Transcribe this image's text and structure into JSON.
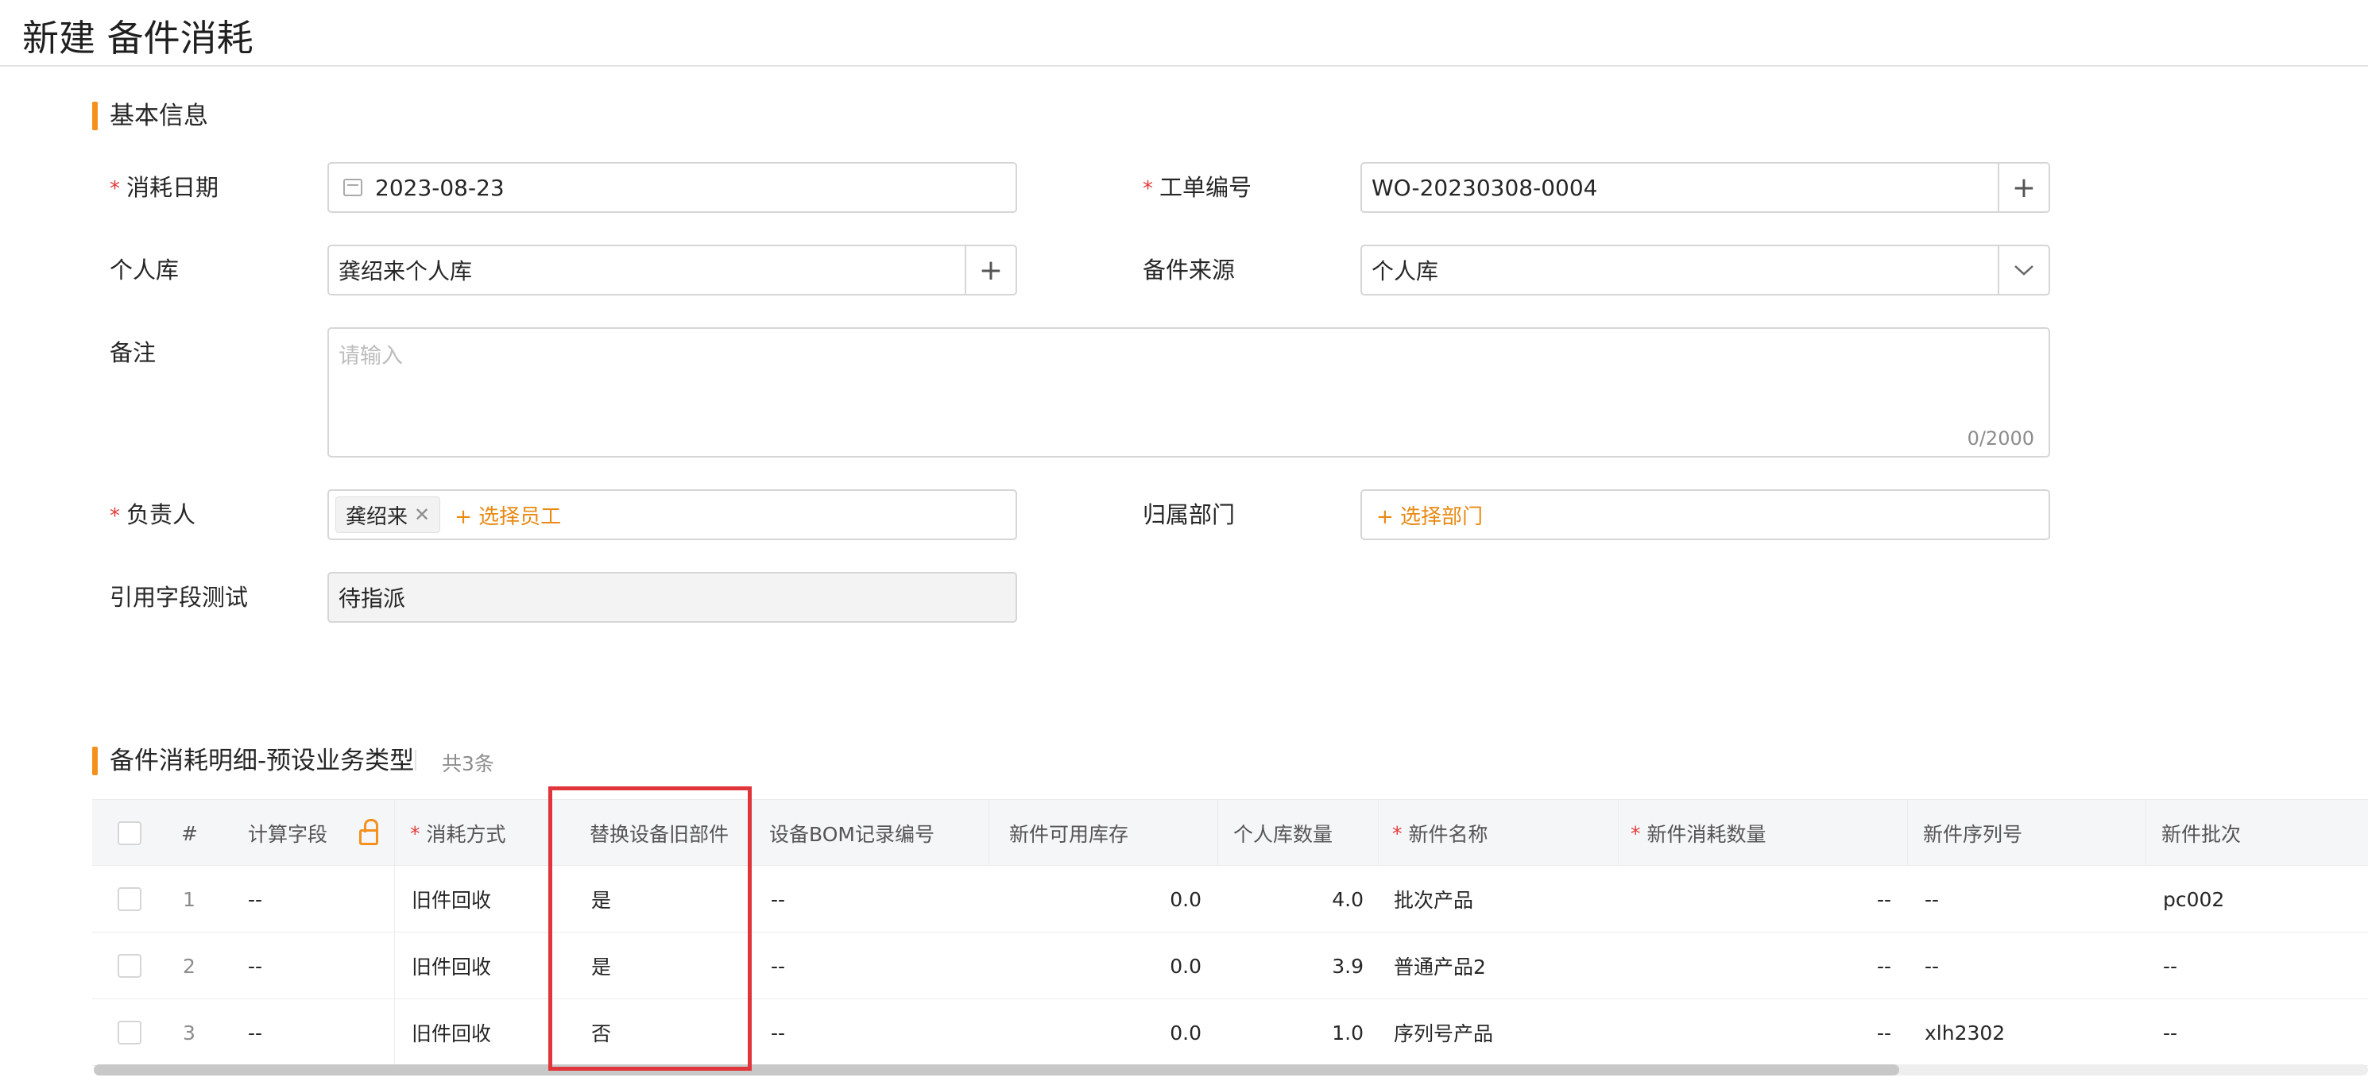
{
  "page": {
    "title": "新建 备件消耗"
  },
  "basic": {
    "section_title": "基本信息",
    "consume_date": {
      "label": "消耗日期",
      "value": "2023-08-23"
    },
    "work_order": {
      "label": "工单编号",
      "value": "WO-20230308-0004"
    },
    "personal_warehouse": {
      "label": "个人库",
      "value": "龚绍来个人库"
    },
    "parts_source": {
      "label": "备件来源",
      "value": "个人库"
    },
    "remark": {
      "label": "备注",
      "placeholder": "请输入",
      "counter": "0/2000"
    },
    "owner": {
      "label": "负责人",
      "tag": "龚绍来",
      "add_label": "+ 选择员工"
    },
    "department": {
      "label": "归属部门",
      "add_label": "+ 选择部门"
    },
    "ref_field": {
      "label": "引用字段测试",
      "value": "待指派"
    }
  },
  "detail": {
    "section_title": "备件消耗明细-预设业务类型",
    "count": "共3条",
    "columns": {
      "index": "#",
      "calc": "计算字段",
      "method": "消耗方式",
      "replace_old": "替换设备旧部件",
      "bom_no": "设备BOM记录编号",
      "new_stock": "新件可用库存",
      "personal_qty": "个人库数量",
      "new_name": "新件名称",
      "new_qty": "新件消耗数量",
      "new_serial": "新件序列号",
      "new_batch": "新件批次"
    },
    "rows": [
      {
        "index": "1",
        "calc": "--",
        "method": "旧件回收",
        "replace_old": "是",
        "bom_no": "--",
        "new_stock": "0.0",
        "personal_qty": "4.0",
        "new_name": "批次产品",
        "new_qty": "--",
        "new_serial": "--",
        "new_batch": "pc002"
      },
      {
        "index": "2",
        "calc": "--",
        "method": "旧件回收",
        "replace_old": "是",
        "bom_no": "--",
        "new_stock": "0.0",
        "personal_qty": "3.9",
        "new_name": "普通产品2",
        "new_qty": "--",
        "new_serial": "--",
        "new_batch": "--"
      },
      {
        "index": "3",
        "calc": "--",
        "method": "旧件回收",
        "replace_old": "否",
        "bom_no": "--",
        "new_stock": "0.0",
        "personal_qty": "1.0",
        "new_name": "序列号产品",
        "new_qty": "--",
        "new_serial": "xlh2302",
        "new_batch": "--"
      }
    ]
  },
  "colors": {
    "accent": "#f5901e",
    "required": "#e23b3b",
    "highlight": "#e0353b",
    "link": "#e88a14"
  }
}
